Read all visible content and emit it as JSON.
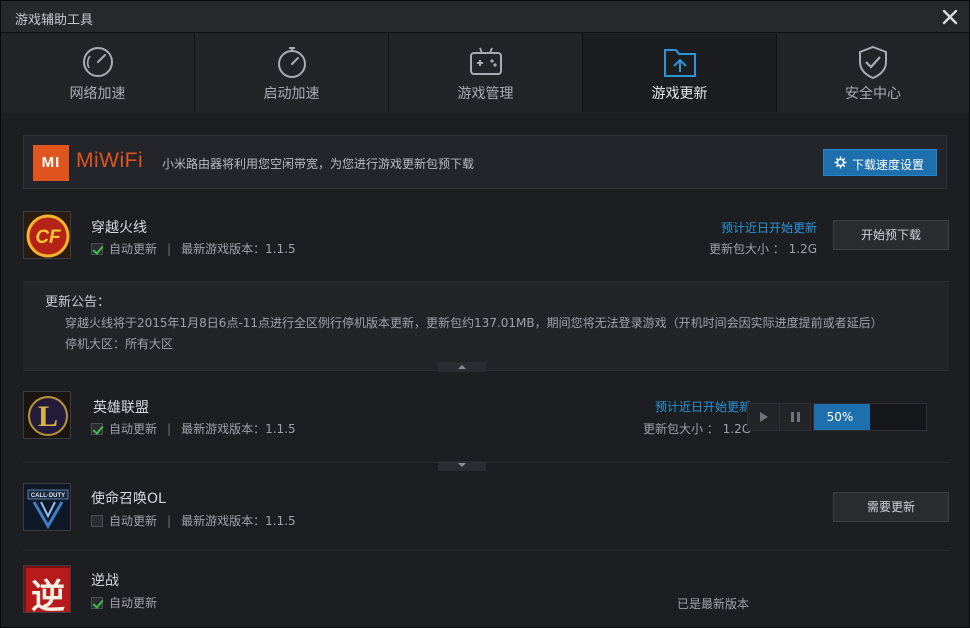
{
  "window": {
    "title": "游戏辅助工具"
  },
  "tabs": [
    {
      "label": "网络加速",
      "icon": "speedometer-icon",
      "active": false
    },
    {
      "label": "启动加速",
      "icon": "stopwatch-icon",
      "active": false
    },
    {
      "label": "游戏管理",
      "icon": "gamepad-icon",
      "active": false
    },
    {
      "label": "游戏更新",
      "icon": "update-folder-icon",
      "active": true
    },
    {
      "label": "安全中心",
      "icon": "shield-check-icon",
      "active": false
    }
  ],
  "banner": {
    "logo": "MI",
    "brand": "MiWiFi",
    "text": "小米路由器将利用您空闲带宽，为您进行游戏更新包预下载",
    "button": "下载速度设置"
  },
  "games": [
    {
      "name": "穿越火线",
      "auto_update_label": "自动更新",
      "auto_update": true,
      "version": "最新游戏版本：1.1.5",
      "status": "预计近日开始更新",
      "size": "更新包大小 ： 1.2G",
      "action": "开始预下载"
    },
    {
      "name": "英雄联盟",
      "auto_update_label": "自动更新",
      "auto_update": true,
      "version": "最新游戏版本：1.1.5",
      "status": "预计近日开始更新",
      "size": "更新包大小 ： 1.2G",
      "progress_text": "50%",
      "progress": 0.5
    },
    {
      "name": "使命召唤OL",
      "auto_update_label": "自动更新",
      "auto_update": false,
      "version": "最新游戏版本：1.1.5",
      "action": "需要更新"
    },
    {
      "name": "逆战",
      "auto_update_label": "自动更新",
      "auto_update": true,
      "status_plain": "已是最新版本"
    }
  ],
  "notice": {
    "title": "更新公告：",
    "line1": "穿越火线将于2015年1月8日6点-11点进行全区例行停机版本更新，更新包约137.01MB，期间您将无法登录游戏（开机时间会因实际进度提前或者延后）",
    "line2": "停机大区：所有大区"
  },
  "icon_chars": {
    "nizhan": "逆"
  },
  "colors": {
    "accent": "#1d6fae",
    "status_blue": "#2a95d8",
    "brand_orange": "#e0551e",
    "check_green": "#3fbf4a"
  }
}
